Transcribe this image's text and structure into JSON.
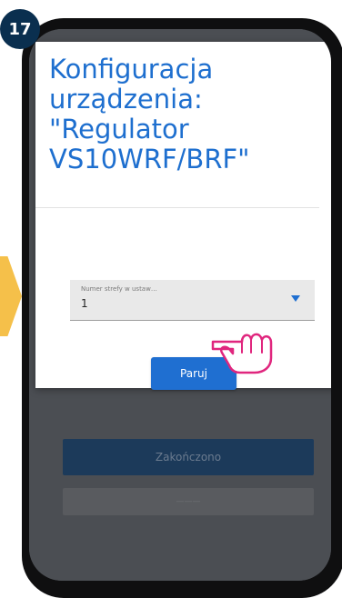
{
  "step": {
    "number": "17"
  },
  "dialog": {
    "title": "Konfiguracja urządzenia: \"Regulator VS10WRF/BRF\"",
    "zone_field": {
      "label": "Numer strefy w ustaw…",
      "value": "1"
    },
    "pair_button": "Paruj"
  },
  "background": {
    "finish_button": "Zakończono",
    "secondary_button": "———"
  },
  "colors": {
    "accent": "#1f6fd1",
    "dark_navy": "#0a2f4f",
    "arrow": "#f5c04a",
    "hand_outline": "#e0267e"
  },
  "icons": {
    "pointer": "hand-pointer-icon",
    "dropdown": "triangle-down-icon"
  }
}
